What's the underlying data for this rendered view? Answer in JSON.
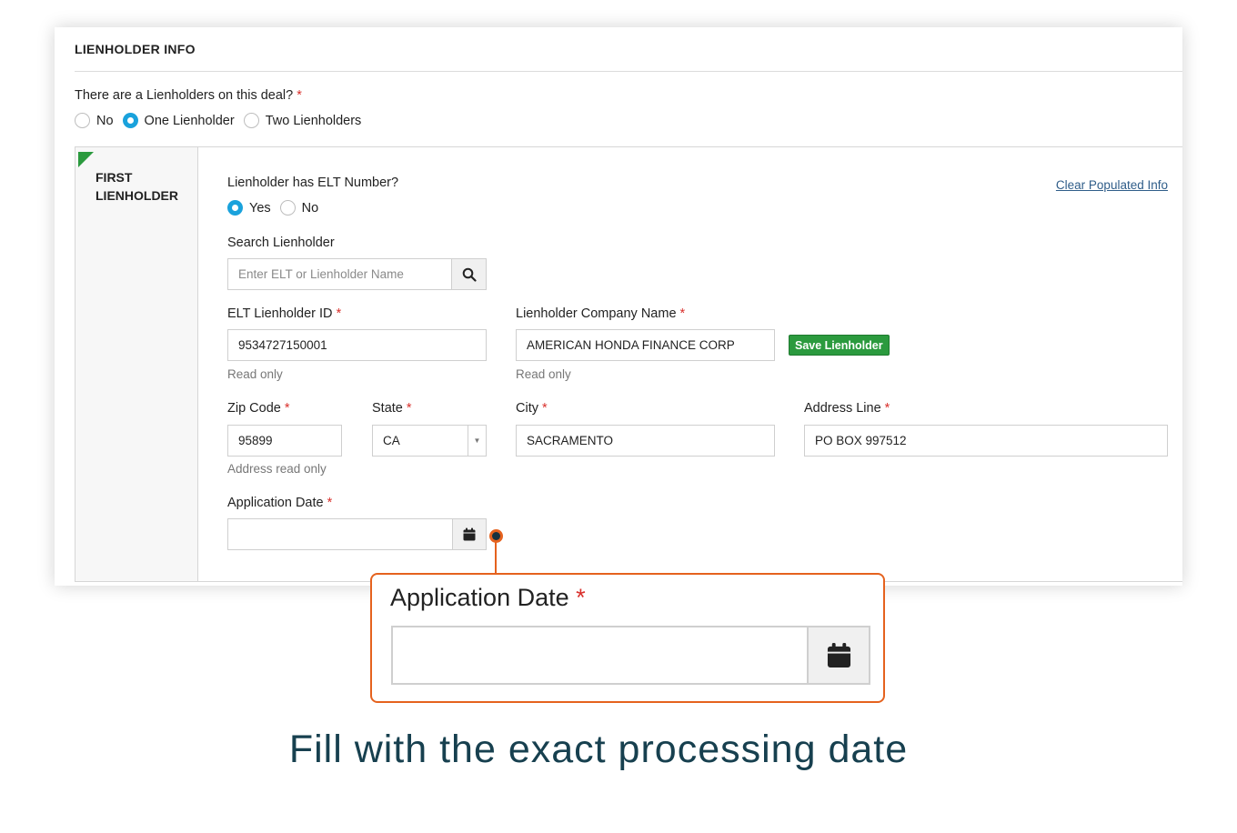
{
  "section": {
    "title": "LIENHOLDER INFO"
  },
  "lienholder_question": {
    "label": "There are a Lienholders on this deal?",
    "required_mark": "*",
    "options": [
      "No",
      "One Lienholder",
      "Two Lienholders"
    ],
    "selected": "One Lienholder"
  },
  "first_lienholder": {
    "side_title_line1": "FIRST",
    "side_title_line2": "LIENHOLDER",
    "clear_link": "Clear Populated Info",
    "elt_question": {
      "label": "Lienholder has ELT Number?",
      "options": [
        "Yes",
        "No"
      ],
      "selected": "Yes"
    },
    "search": {
      "label": "Search Lienholder",
      "placeholder": "Enter ELT or Lienholder Name",
      "icon": "search-icon"
    },
    "elt_id": {
      "label": "ELT Lienholder ID",
      "required_mark": "*",
      "value": "9534727150001",
      "help": "Read only"
    },
    "company_name": {
      "label": "Lienholder Company Name",
      "required_mark": "*",
      "value": "AMERICAN HONDA FINANCE CORP",
      "help": "Read only"
    },
    "save_button": "Save Lienholder",
    "zip": {
      "label": "Zip Code",
      "required_mark": "*",
      "value": "95899",
      "help": "Address read only"
    },
    "state": {
      "label": "State",
      "required_mark": "*",
      "value": "CA"
    },
    "city": {
      "label": "City",
      "required_mark": "*",
      "value": "SACRAMENTO"
    },
    "address": {
      "label": "Address Line",
      "required_mark": "*",
      "value": "PO BOX 997512"
    },
    "application_date": {
      "label": "Application Date",
      "required_mark": "*",
      "value": "",
      "icon": "calendar-icon"
    }
  },
  "callout": {
    "label": "Application Date",
    "required_mark": "*",
    "value": "",
    "icon": "calendar-icon"
  },
  "caption": "Fill with the exact processing date",
  "colors": {
    "accent_blue": "#1aa2dc",
    "save_green": "#2b9a3e",
    "callout_orange": "#e5621e",
    "required_red": "#d9302c",
    "caption_teal": "#17404f"
  }
}
